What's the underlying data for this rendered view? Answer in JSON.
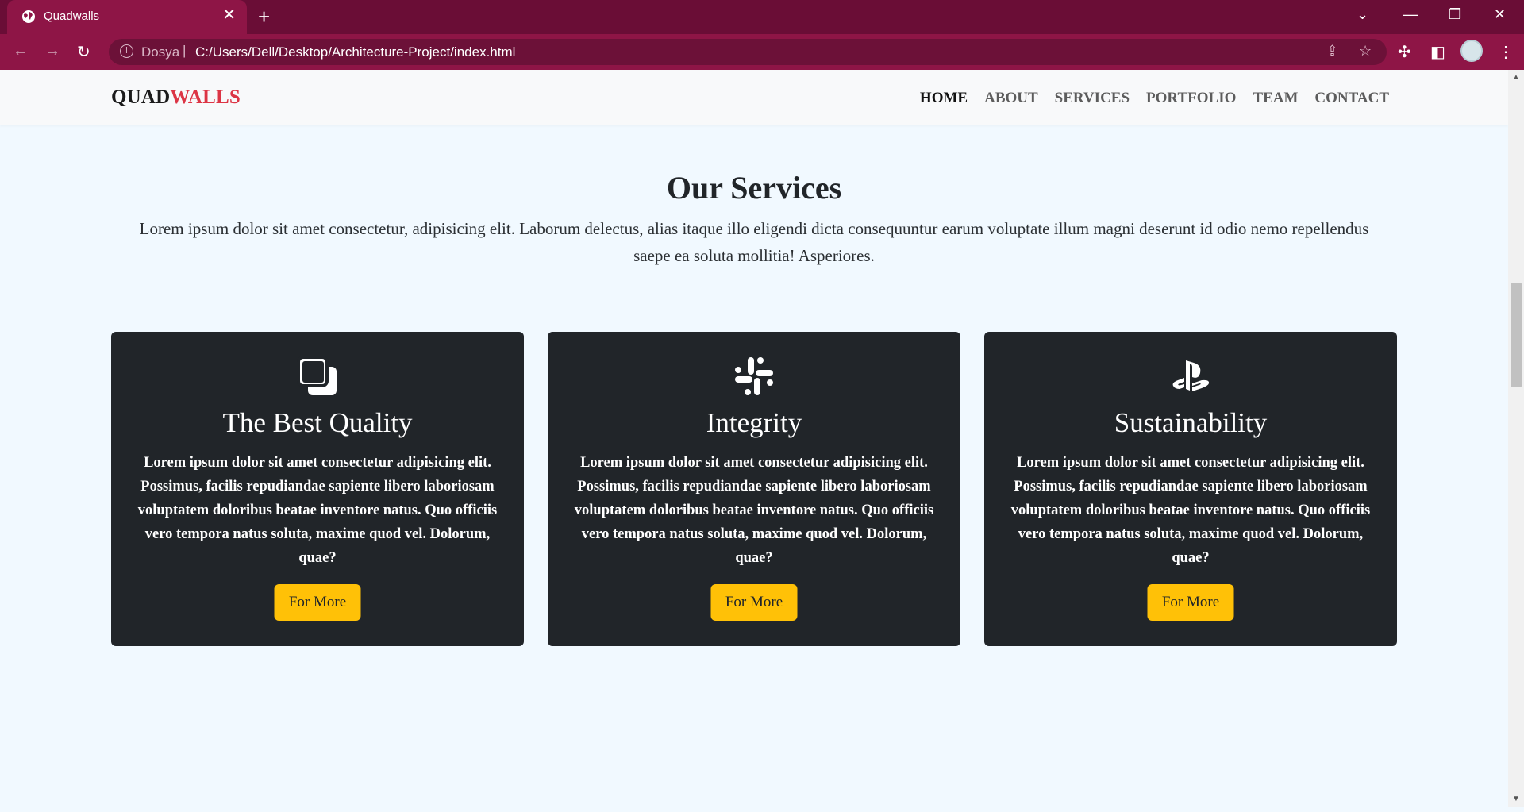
{
  "browser": {
    "tab_title": "Quadwalls",
    "tab_close": "✕",
    "new_tab": "+",
    "window_controls": {
      "dropdown": "⌄",
      "minimize": "—",
      "restore": "❐",
      "close": "✕"
    },
    "nav_back": "←",
    "nav_forward": "→",
    "reload": "↻",
    "address_scheme": "Dosya",
    "address_separator": "|",
    "address_url": "C:/Users/Dell/Desktop/Architecture-Project/index.html",
    "icons": {
      "share": "⇪",
      "bookmark": "☆",
      "extensions": "✣",
      "sidepanel": "◧",
      "menu": "⋮"
    },
    "accent_color": "#8e1546",
    "tab_strip_color": "#6a0d36"
  },
  "site": {
    "brand": {
      "part1": "QUAD",
      "part2": "WALLS"
    },
    "nav": {
      "home": "HOME",
      "about": "ABOUT",
      "services": "SERVICES",
      "portfolio": "PORTFOLIO",
      "team": "TEAM",
      "contact": "CONTACT"
    },
    "services": {
      "title": "Our Services",
      "description": "Lorem ipsum dolor sit amet consectetur, adipisicing elit. Laborum delectus, alias itaque illo eligendi dicta consequuntur earum voluptate illum magni deserunt id odio nemo repellendus saepe ea soluta mollitia! Asperiores.",
      "cards": [
        {
          "icon": "copy-squares-icon",
          "title": "The Best Quality",
          "text": "Lorem ipsum dolor sit amet consectetur adipisicing elit. Possimus, facilis repudiandae sapiente libero laboriosam voluptatem doloribus beatae inventore natus. Quo officiis vero tempora natus soluta, maxime quod vel. Dolorum, quae?",
          "button": "For More"
        },
        {
          "icon": "slack-icon",
          "title": "Integrity",
          "text": "Lorem ipsum dolor sit amet consectetur adipisicing elit. Possimus, facilis repudiandae sapiente libero laboriosam voluptatem doloribus beatae inventore natus. Quo officiis vero tempora natus soluta, maxime quod vel. Dolorum, quae?",
          "button": "For More"
        },
        {
          "icon": "playstation-icon",
          "title": "Sustainability",
          "text": "Lorem ipsum dolor sit amet consectetur adipisicing elit. Possimus, facilis repudiandae sapiente libero laboriosam voluptatem doloribus beatae inventore natus. Quo officiis vero tempora natus soluta, maxime quod vel. Dolorum, quae?",
          "button": "For More"
        }
      ]
    },
    "colors": {
      "brand_accent": "#dc3545",
      "card_bg": "#212529",
      "button_bg": "#ffc107"
    }
  }
}
